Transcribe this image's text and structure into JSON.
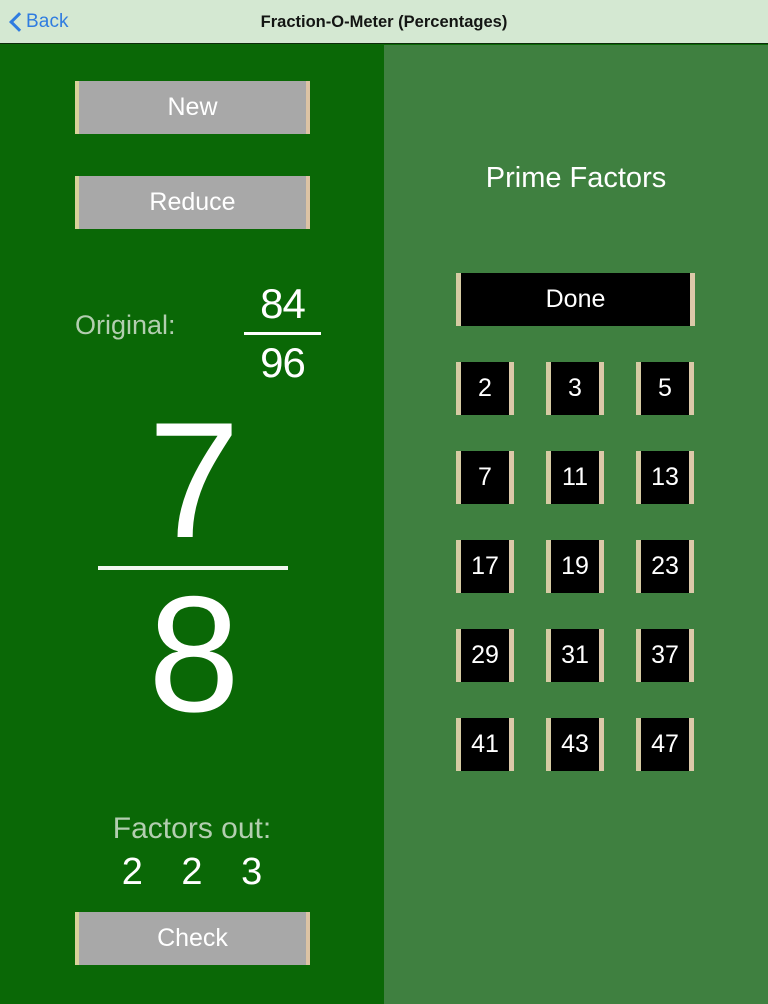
{
  "navbar": {
    "back_label": "Back",
    "back_icon": "chevron-left-icon",
    "title": "Fraction-O-Meter (Percentages)",
    "background_color": "#d4e8d2",
    "accent_color": "#2f7ce0"
  },
  "theme": {
    "left_panel_color": "#0a6806",
    "right_panel_color": "#3f8040",
    "button_grey": "#a8a8a8",
    "button_black": "#000000",
    "button_border_left": "#d8d29a",
    "button_border_right": "#dcc3a4",
    "muted_text_color": "#b3ceb0",
    "text_color": "#ffffff"
  },
  "left_panel": {
    "new_button": "New",
    "reduce_button": "Reduce",
    "check_button": "Check",
    "original": {
      "label": "Original:",
      "numerator": "84",
      "denominator": "96"
    },
    "current": {
      "numerator": "7",
      "denominator": "8"
    },
    "factors_out": {
      "label": "Factors out:",
      "values": "2 2 3",
      "list": [
        "2",
        "2",
        "3"
      ]
    }
  },
  "right_panel": {
    "title": "Prime Factors",
    "done_button": "Done",
    "primes": [
      "2",
      "3",
      "5",
      "7",
      "11",
      "13",
      "17",
      "19",
      "23",
      "29",
      "31",
      "37",
      "41",
      "43",
      "47"
    ]
  }
}
